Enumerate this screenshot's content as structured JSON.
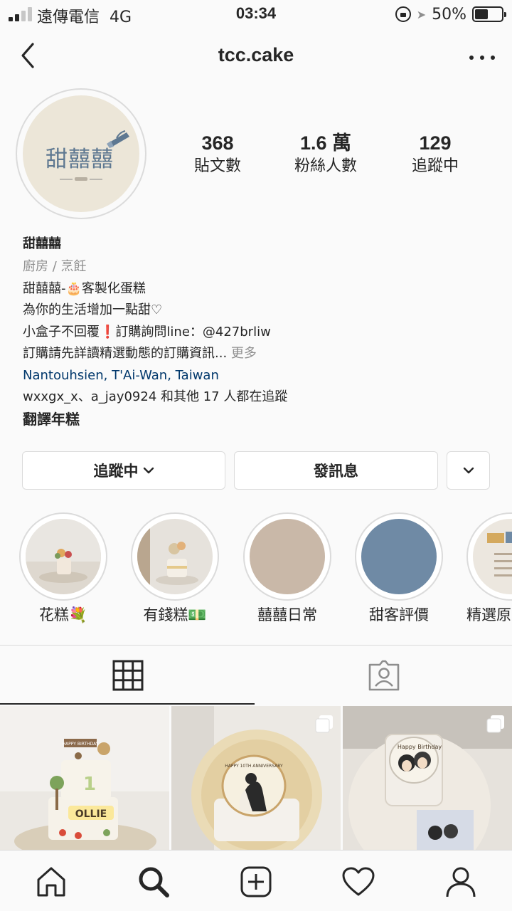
{
  "status_bar": {
    "carrier": "遠傳電信",
    "network": "4G",
    "time": "03:34",
    "battery_text": "50%",
    "battery_level": 0.5,
    "signal_bars_active": 2
  },
  "nav": {
    "username": "tcc.cake"
  },
  "profile": {
    "avatar_text": "甜囍囍",
    "stats": [
      {
        "value": "368",
        "label": "貼文數"
      },
      {
        "value": "1.6 萬",
        "label": "粉絲人數"
      },
      {
        "value": "129",
        "label": "追蹤中"
      }
    ]
  },
  "bio": {
    "name": "甜囍囍",
    "category": "廚房 / 烹飪",
    "lines": [
      "甜囍囍-🎂客製化蛋糕",
      "為你的生活增加一點甜♡",
      "小盒子不回覆❗️訂購詢問line：@427brliw",
      "訂購請先詳讀精選動態的訂購資訊..."
    ],
    "more_label": "更多",
    "location": "Nantouhsien, T'Ai-Wan, Taiwan",
    "followed_by": "wxxgx_x、a_jay0924 和其他 17 人都在追蹤",
    "translate_label": "翻譯年糕"
  },
  "actions": {
    "following_label": "追蹤中",
    "message_label": "發訊息"
  },
  "highlights": [
    {
      "label": "花糕💐"
    },
    {
      "label": "有錢糕💵"
    },
    {
      "label": "囍囍日常"
    },
    {
      "label": "甜客評價"
    },
    {
      "label": "精選原"
    }
  ],
  "grid_posts": [
    {
      "cake_text": "OLLIE",
      "topper": "HAPPY BIRTHDAY",
      "number": "1"
    },
    {
      "cake_text": "",
      "topper": "HAPPY 10TH ANNIVERSARY"
    },
    {
      "cake_text": "",
      "topper": "Happy Birthday"
    }
  ],
  "colors": {
    "text": "#262626",
    "secondary": "#8e8e8e",
    "link": "#00376b",
    "border": "#dbdbdb",
    "background": "#fafafa",
    "avatar_bg": "#ece6d8",
    "highlight_beige": "#c9b8a8",
    "highlight_blue": "#6f8aa5"
  },
  "icons": {
    "back": "chevron-left-icon",
    "more": "more-horizontal-icon",
    "grid_tab": "grid-icon",
    "tagged_tab": "tagged-person-icon",
    "home": "home-icon",
    "search": "search-icon",
    "new_post": "plus-square-icon",
    "activity": "heart-icon",
    "profile": "person-icon"
  }
}
